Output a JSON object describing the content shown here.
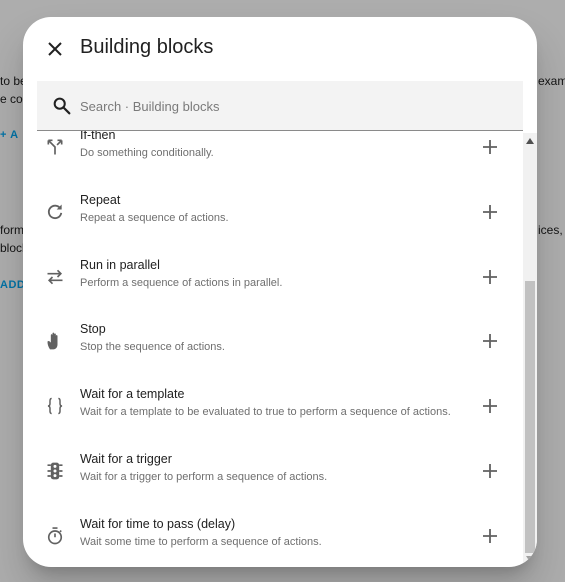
{
  "background": {
    "line1_left": "to be",
    "line1_right": "exam",
    "line2_left": "e co",
    "add_link_1": "+ A",
    "line3_left": "form",
    "line3_right": "ices,",
    "line4_left": "block",
    "add_link_2": "ADD"
  },
  "dialog": {
    "title": "Building blocks",
    "search_placeholder": "Search · Building blocks",
    "items": [
      {
        "title": "If-then",
        "description": "Do something conditionally.",
        "icon": "call-split-icon"
      },
      {
        "title": "Repeat",
        "description": "Repeat a sequence of actions.",
        "icon": "refresh-icon"
      },
      {
        "title": "Run in parallel",
        "description": "Perform a sequence of actions in parallel.",
        "icon": "shuffle-arrows-icon"
      },
      {
        "title": "Stop",
        "description": "Stop the sequence of actions.",
        "icon": "hand-stop-icon"
      },
      {
        "title": "Wait for a template",
        "description": "Wait for a template to be evaluated to true to perform a sequence of actions.",
        "icon": "code-braces-icon"
      },
      {
        "title": "Wait for a trigger",
        "description": "Wait for a trigger to perform a sequence of actions.",
        "icon": "traffic-light-icon"
      },
      {
        "title": "Wait for time to pass (delay)",
        "description": "Wait some time to perform a sequence of actions.",
        "icon": "timer-icon"
      }
    ]
  },
  "colors": {
    "icon": "#616161",
    "title": "#212121",
    "description": "#6f6f6f",
    "accent": "#03a9f4"
  }
}
